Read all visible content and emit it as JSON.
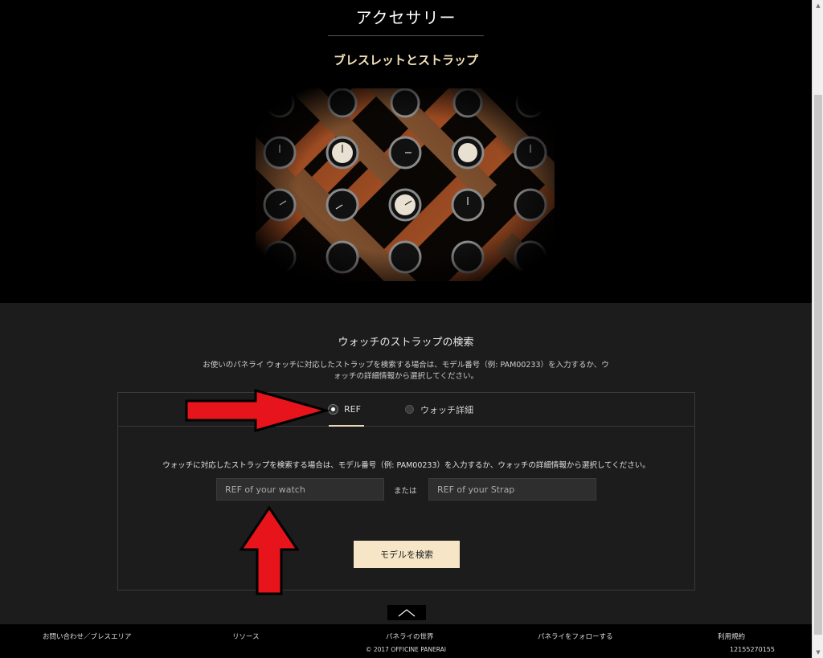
{
  "hero": {
    "title": "アクセサリー",
    "subtitle": "ブレスレットとストラップ",
    "image": "watch-strap-weave-photo"
  },
  "search": {
    "heading": "ウォッチのストラップの検索",
    "description": "お使いのパネライ ウォッチに対応したストラップを検索する場合は、モデル番号（例: PAM00233）を入力するか、ウォッチの詳細情報から選択してください。",
    "tabs": [
      {
        "label": "REF",
        "selected": true
      },
      {
        "label": "ウォッチ詳細",
        "selected": false
      }
    ],
    "panel_description": "ウォッチに対応したストラップを検索する場合は、モデル番号（例: PAM00233）を入力するか、ウォッチの詳細情報から選択してください。",
    "watch_ref_placeholder": "REF of your watch",
    "or_label": "または",
    "strap_ref_placeholder": "REF of your Strap",
    "search_button": "モデルを検索"
  },
  "footer": {
    "links": [
      "お問い合わせ／ブレスエリア",
      "リソース",
      "パネライの世界",
      "パネライをフォローする",
      "利用規約"
    ],
    "copyright": "© 2017 OFFICINE PANERAI",
    "number": "12155270155"
  },
  "colors": {
    "accent": "#f6e6c7",
    "annotation_arrow": "#e8141c",
    "panel_bg": "#1c1c1c"
  }
}
